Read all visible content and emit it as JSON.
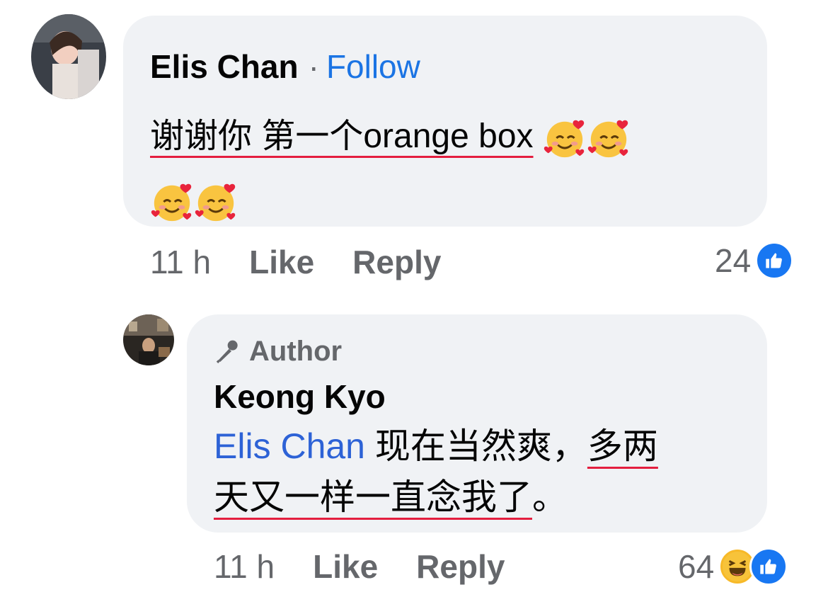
{
  "comment": {
    "author": "Elis Chan",
    "separator": "·",
    "follow_label": "Follow",
    "text_underlined": "谢谢你 第一个orange box",
    "emoji_count": 4,
    "emoji_name": "smiling-face-with-hearts",
    "time": "11 h",
    "like_label": "Like",
    "reply_label": "Reply",
    "reaction_count": "24",
    "reactions": [
      "like"
    ]
  },
  "reply": {
    "badge_label": "Author",
    "author": "Keong Kyo",
    "mention": "Elis Chan",
    "text_part1": "现在当然爽，",
    "text_part2_underlined_a": "多两",
    "text_part2_underlined_b": "天又一样一直念我了",
    "text_end": "。",
    "time": "11 h",
    "like_label": "Like",
    "reply_label": "Reply",
    "reaction_count": "64",
    "reactions": [
      "haha",
      "like"
    ]
  },
  "colors": {
    "bubble": "#f0f2f5",
    "link_blue": "#1b74e4",
    "meta_gray": "#65676b",
    "underline_red": "#e41e3f",
    "like_blue": "#1877f2"
  }
}
